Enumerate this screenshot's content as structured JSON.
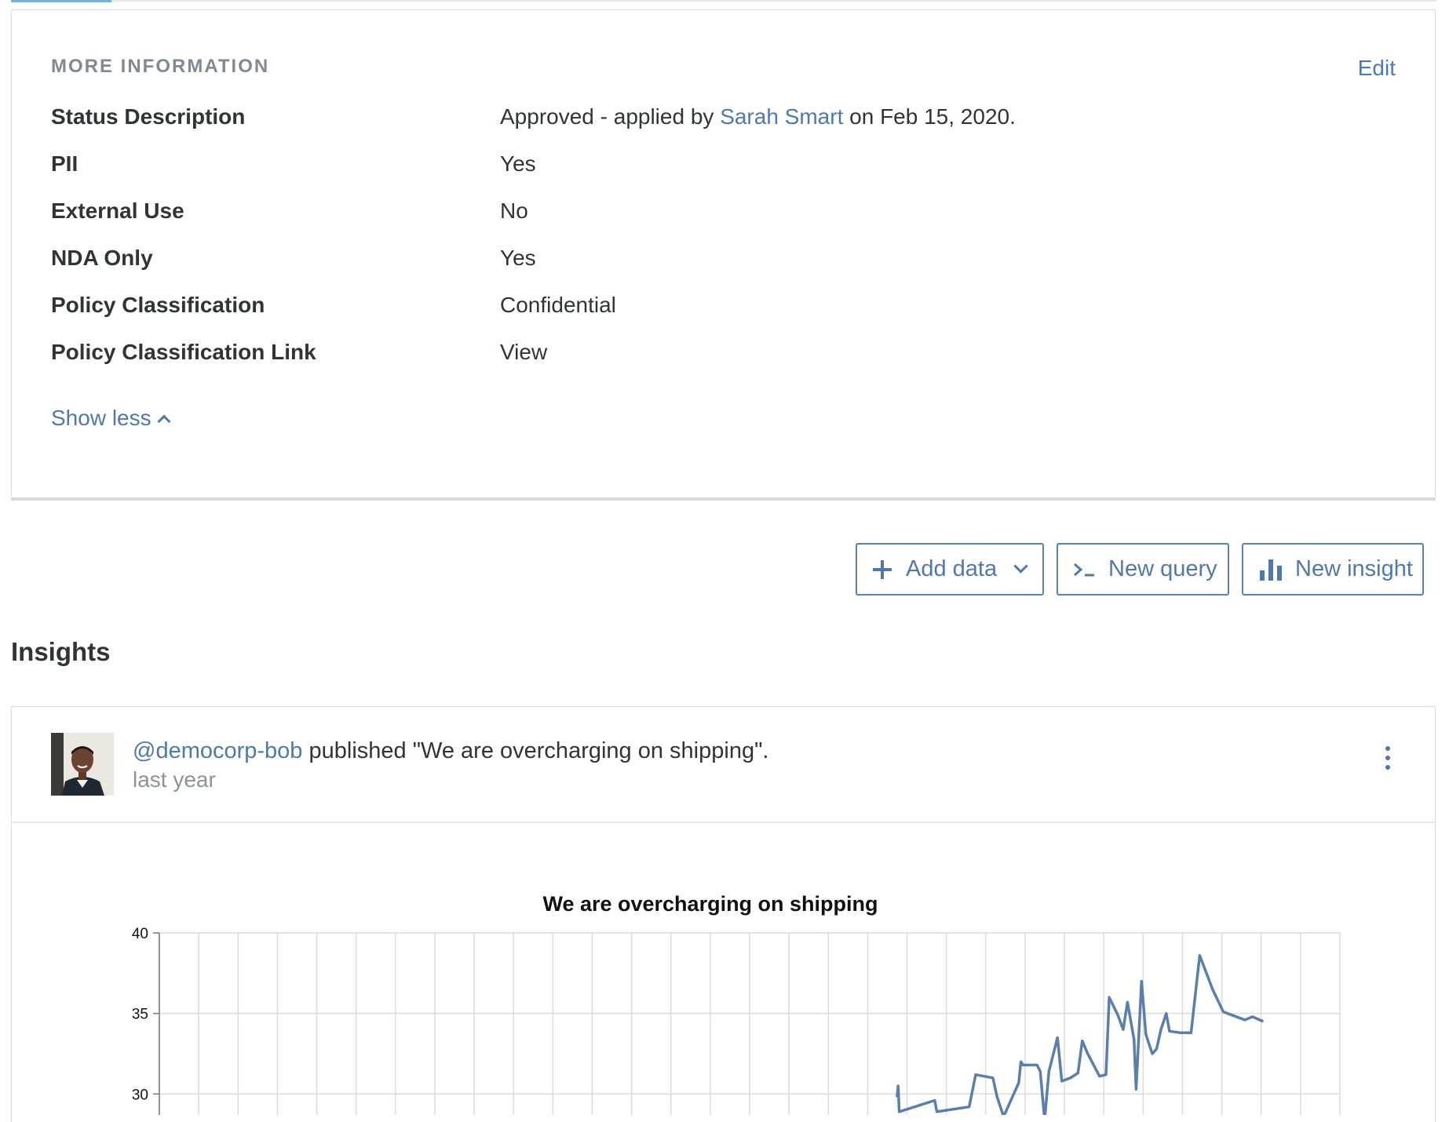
{
  "more_info": {
    "heading": "MORE INFORMATION",
    "edit_label": "Edit",
    "rows": [
      {
        "label": "Status Description",
        "value_prefix": "Approved - applied by ",
        "value_link": "Sarah Smart",
        "value_suffix": " on Feb 15, 2020."
      },
      {
        "label": "PII",
        "value": "Yes"
      },
      {
        "label": "External Use",
        "value": "No"
      },
      {
        "label": "NDA Only",
        "value": "Yes"
      },
      {
        "label": "Policy Classification",
        "value": "Confidential"
      },
      {
        "label": "Policy Classification Link",
        "value_link": "View"
      }
    ],
    "show_less_label": "Show less",
    "show_less_icon": "chevron-up-icon"
  },
  "actions": {
    "add_data_label": "Add data",
    "add_data_icon": "plus-icon",
    "add_data_caret_icon": "chevron-down-icon",
    "new_query_label": "New query",
    "new_query_icon": "terminal-icon",
    "new_insight_label": "New insight",
    "new_insight_icon": "bar-chart-icon"
  },
  "insights": {
    "title": "Insights",
    "feed": {
      "author": "@democorp-bob",
      "action_text": " published \"We are overcharging on shipping\".",
      "time": "last year",
      "menu_icon": "kebab-menu-icon"
    }
  },
  "colors": {
    "accent": "#4f79ad",
    "series_line": "#5b7fad",
    "text": "#2f3437",
    "muted": "#7f8a94"
  },
  "chart_data": {
    "type": "line",
    "title": "We are overcharging on shipping",
    "xlabel": "",
    "ylabel": "",
    "ylim": [
      28.7,
      40
    ],
    "yticks": [
      30,
      35,
      40
    ],
    "grid": true,
    "series": [
      {
        "values": [
          [
            0.685,
            29.8
          ],
          [
            0.686,
            30.5
          ],
          [
            0.687,
            28.9
          ],
          [
            0.72,
            29.6
          ],
          [
            0.722,
            28.9
          ],
          [
            0.752,
            29.2
          ],
          [
            0.758,
            31.2
          ],
          [
            0.774,
            31.0
          ],
          [
            0.778,
            29.8
          ],
          [
            0.784,
            28.6
          ],
          [
            0.798,
            30.7
          ],
          [
            0.8,
            32.0
          ],
          [
            0.802,
            31.8
          ],
          [
            0.815,
            31.8
          ],
          [
            0.818,
            31.4
          ],
          [
            0.822,
            28.4
          ],
          [
            0.826,
            31.4
          ],
          [
            0.834,
            33.5
          ],
          [
            0.838,
            30.8
          ],
          [
            0.846,
            31.0
          ],
          [
            0.853,
            31.3
          ],
          [
            0.857,
            33.3
          ],
          [
            0.862,
            32.5
          ],
          [
            0.873,
            31.1
          ],
          [
            0.879,
            31.2
          ],
          [
            0.882,
            36.0
          ],
          [
            0.89,
            34.9
          ],
          [
            0.895,
            34.0
          ],
          [
            0.899,
            35.7
          ],
          [
            0.905,
            33.4
          ],
          [
            0.907,
            30.3
          ],
          [
            0.912,
            37.0
          ],
          [
            0.916,
            33.7
          ],
          [
            0.922,
            32.5
          ],
          [
            0.926,
            32.8
          ],
          [
            0.93,
            34.0
          ],
          [
            0.935,
            35.0
          ],
          [
            0.938,
            33.9
          ],
          [
            0.948,
            33.8
          ],
          [
            0.958,
            33.8
          ],
          [
            0.966,
            38.6
          ],
          [
            0.978,
            36.5
          ],
          [
            0.988,
            35.1
          ],
          [
            1.0,
            34.8
          ],
          [
            1.008,
            34.6
          ],
          [
            1.015,
            34.8
          ],
          [
            1.025,
            34.5
          ]
        ]
      }
    ]
  }
}
